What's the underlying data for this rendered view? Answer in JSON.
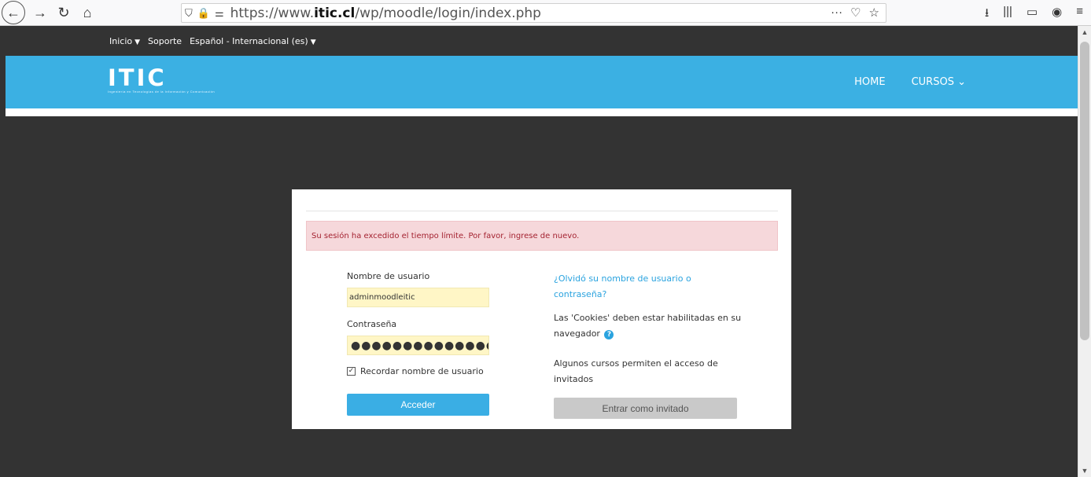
{
  "browser": {
    "url_prefix": "https://www.",
    "url_domain": "itic.cl",
    "url_path": "/wp/moodle/login/index.php",
    "icons": [
      "back-icon",
      "forward-icon",
      "reload-icon",
      "home-icon",
      "shield-icon",
      "lock-icon",
      "permissions-icon",
      "more-icon",
      "pocket-icon",
      "bookmark-star-icon",
      "download-icon",
      "library-icon",
      "sidebar-icon",
      "account-icon",
      "menu-icon"
    ]
  },
  "topnav": {
    "inicio": "Inicio",
    "soporte": "Soporte",
    "idioma": "Español - Internacional (es)"
  },
  "header": {
    "logo": "ITIC",
    "logo_subtitle": "Ingeniería en Tecnologías de la Información y Comunicación",
    "home": "HOME",
    "cursos": "CURSOS"
  },
  "login": {
    "alert": "Su sesión ha excedido el tiempo límite. Por favor, ingrese de nuevo.",
    "username_label": "Nombre de usuario",
    "username_value": "adminmoodleitic",
    "password_label": "Contraseña",
    "password_value": "●●●●●●●●●●●●●●",
    "remember_label": "Recordar nombre de usuario",
    "remember_checked": true,
    "submit": "Acceder",
    "forgot_link": "¿Olvidó su nombre de usuario o contraseña?",
    "cookies_text": "Las 'Cookies' deben estar habilitadas en su navegador",
    "guest_text": "Algunos cursos permiten el acceso de invitados",
    "guest_button": "Entrar como invitado"
  },
  "colors": {
    "header_blue": "#3bb0e3",
    "page_dark": "#333333",
    "alert_bg": "#f6d8db",
    "alert_text": "#a42331",
    "field_bg": "#fff6c6"
  }
}
